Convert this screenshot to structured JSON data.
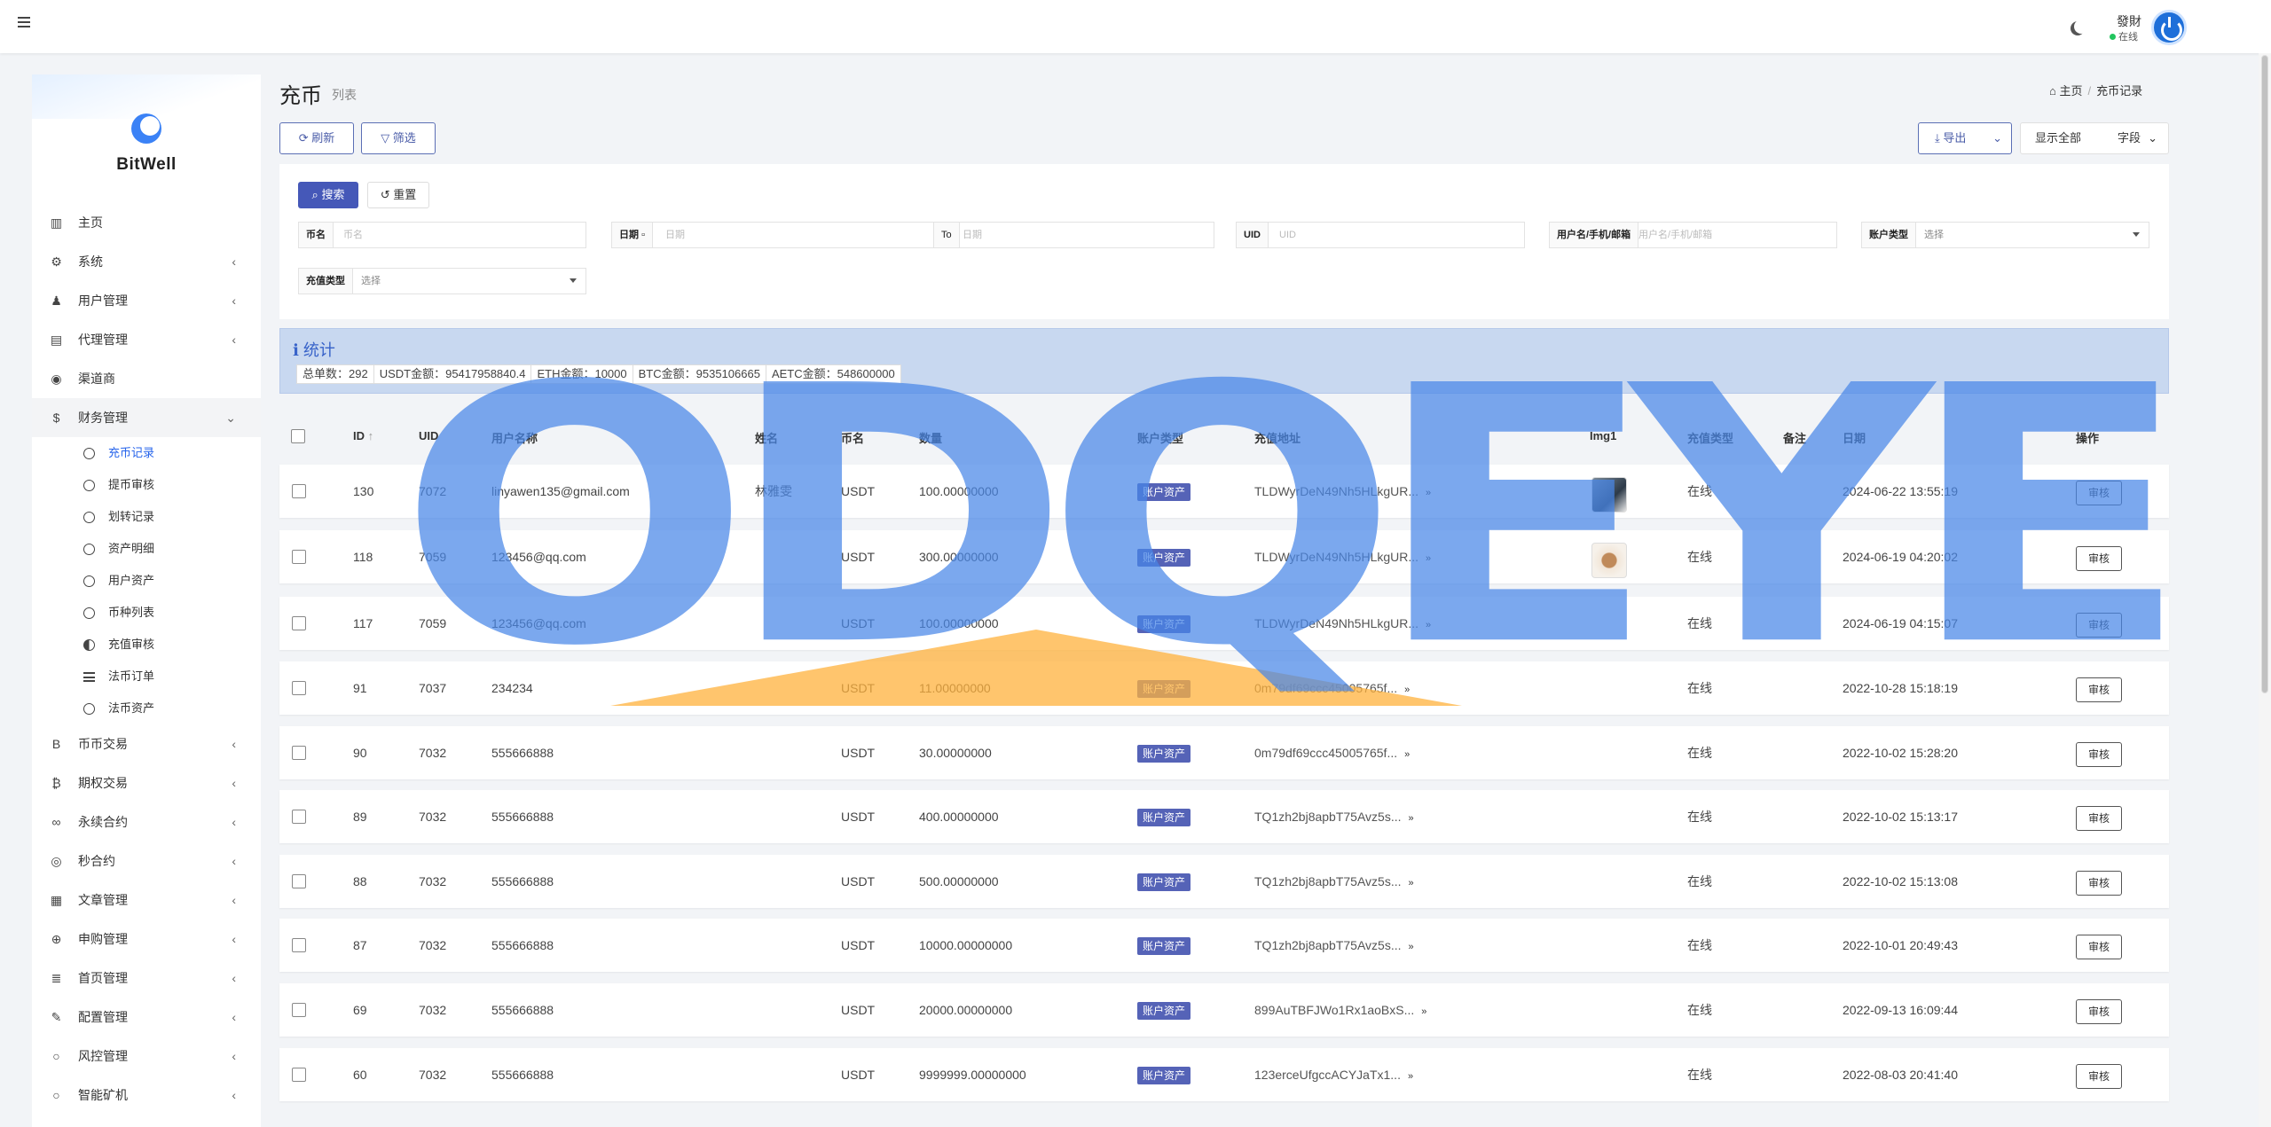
{
  "topbar": {
    "user_name": "發財",
    "user_status": "在线"
  },
  "brand": "BitWell",
  "sidebar": {
    "items": [
      {
        "label": "主页",
        "icon": "bar-chart-icon",
        "glyph": "▥",
        "chev": ""
      },
      {
        "label": "系统",
        "icon": "gear-icon",
        "glyph": "⚙",
        "chev": "‹"
      },
      {
        "label": "用户管理",
        "icon": "user-tie-icon",
        "glyph": "♟",
        "chev": "‹"
      },
      {
        "label": "代理管理",
        "icon": "id-card-icon",
        "glyph": "▤",
        "chev": "‹"
      },
      {
        "label": "渠道商",
        "icon": "user-circle-icon",
        "glyph": "◉",
        "chev": ""
      },
      {
        "label": "财务管理",
        "icon": "dollar-icon",
        "glyph": "$",
        "chev": "⌄"
      }
    ],
    "sub_items": [
      {
        "label": "充币记录",
        "icon": "circle-icon"
      },
      {
        "label": "提币审核",
        "icon": "circle-icon"
      },
      {
        "label": "划转记录",
        "icon": "circle-icon"
      },
      {
        "label": "资产明细",
        "icon": "circle-icon"
      },
      {
        "label": "用户资产",
        "icon": "circle-icon"
      },
      {
        "label": "币种列表",
        "icon": "circle-icon"
      },
      {
        "label": "充值审核",
        "icon": "half-circle-icon"
      },
      {
        "label": "法币订单",
        "icon": "list-icon"
      },
      {
        "label": "法币资产",
        "icon": "circle-icon"
      }
    ],
    "items2": [
      {
        "label": "币币交易",
        "icon": "bitcoin-b-icon",
        "glyph": "B",
        "chev": "‹"
      },
      {
        "label": "期权交易",
        "icon": "bitcoin-icon",
        "glyph": "₿",
        "chev": "‹"
      },
      {
        "label": "永续合约",
        "icon": "link-icon",
        "glyph": "∞",
        "chev": "‹"
      },
      {
        "label": "秒合约",
        "icon": "dot-circle-icon",
        "glyph": "◎",
        "chev": "‹"
      },
      {
        "label": "文章管理",
        "icon": "newspaper-icon",
        "glyph": "▦",
        "chev": "‹"
      },
      {
        "label": "申购管理",
        "icon": "globe-icon",
        "glyph": "⊕",
        "chev": "‹"
      },
      {
        "label": "首页管理",
        "icon": "bars-icon",
        "glyph": "≣",
        "chev": "‹"
      },
      {
        "label": "配置管理",
        "icon": "wrench-icon",
        "glyph": "✎",
        "chev": "‹"
      },
      {
        "label": "风控管理",
        "icon": "circle-icon",
        "glyph": "○",
        "chev": "‹"
      },
      {
        "label": "智能矿机",
        "icon": "circle-icon",
        "glyph": "○",
        "chev": "‹"
      }
    ]
  },
  "page": {
    "title": "充币",
    "subtitle": "列表"
  },
  "breadcrumb": {
    "home": "主页",
    "current": "充币记录"
  },
  "toolbar": {
    "refresh": "刷新",
    "filter": "筛选",
    "export": "导出",
    "show_all": "显示全部",
    "fields": "字段"
  },
  "filter": {
    "search": "搜索",
    "reset": "重置",
    "coin_label": "币名",
    "coin_ph": "币名",
    "date_label": "日期",
    "date_from_ph": "日期",
    "date_to": "To",
    "date_to_ph": "日期",
    "uid_label": "UID",
    "uid_ph": "UID",
    "user_label": "用户名/手机/邮箱",
    "user_ph": "用户名/手机/邮箱",
    "account_label": "账户类型",
    "account_value": "选择",
    "recharge_label": "充值类型",
    "recharge_value": "选择"
  },
  "stats": {
    "title": "统计",
    "items": [
      "总单数：292",
      "USDT金额：95417958840.4",
      "ETH金额：10000",
      "BTC金额：9535106665",
      "AETC金额：548600000"
    ]
  },
  "table": {
    "headers": [
      "ID",
      "UID",
      "用户名称",
      "姓名",
      "币名",
      "数量",
      "账户类型",
      "充值地址",
      "Img1",
      "充值类型",
      "备注",
      "日期",
      "操作"
    ],
    "rows": [
      {
        "id": "130",
        "uid": "7072",
        "user": "linyawen135@gmail.com",
        "name": "林雅雯",
        "coin": "USDT",
        "qty": "100.00000000",
        "acct": "账户资产",
        "addr": "TLDWyrDeN49Nh5HLkgUR...",
        "img": "y",
        "type": "在线",
        "note": "",
        "date": "2024-06-22 13:55:19",
        "action": "审核"
      },
      {
        "id": "118",
        "uid": "7059",
        "user": "123456@qq.com",
        "name": "",
        "coin": "USDT",
        "qty": "300.00000000",
        "acct": "账户资产",
        "addr": "TLDWyrDeN49Nh5HLkgUR...",
        "img": "y",
        "type": "在线",
        "note": "",
        "date": "2024-06-19 04:20:02",
        "action": "审核"
      },
      {
        "id": "117",
        "uid": "7059",
        "user": "123456@qq.com",
        "name": "",
        "coin": "USDT",
        "qty": "100.00000000",
        "acct": "账户资产",
        "addr": "TLDWyrDeN49Nh5HLkgUR...",
        "img": "",
        "type": "在线",
        "note": "",
        "date": "2024-06-19 04:15:07",
        "action": "审核"
      },
      {
        "id": "91",
        "uid": "7037",
        "user": "234234",
        "name": "",
        "coin": "USDT",
        "qty": "11.00000000",
        "acct": "账户资产",
        "addr": "0m79df69ccc45005765f...",
        "img": "",
        "type": "在线",
        "note": "",
        "date": "2022-10-28 15:18:19",
        "action": "审核"
      },
      {
        "id": "90",
        "uid": "7032",
        "user": "555666888",
        "name": "",
        "coin": "USDT",
        "qty": "30.00000000",
        "acct": "账户资产",
        "addr": "0m79df69ccc45005765f...",
        "img": "",
        "type": "在线",
        "note": "",
        "date": "2022-10-02 15:28:20",
        "action": "审核"
      },
      {
        "id": "89",
        "uid": "7032",
        "user": "555666888",
        "name": "",
        "coin": "USDT",
        "qty": "400.00000000",
        "acct": "账户资产",
        "addr": "TQ1zh2bj8apbT75Avz5s...",
        "img": "",
        "type": "在线",
        "note": "",
        "date": "2022-10-02 15:13:17",
        "action": "审核"
      },
      {
        "id": "88",
        "uid": "7032",
        "user": "555666888",
        "name": "",
        "coin": "USDT",
        "qty": "500.00000000",
        "acct": "账户资产",
        "addr": "TQ1zh2bj8apbT75Avz5s...",
        "img": "",
        "type": "在线",
        "note": "",
        "date": "2022-10-02 15:13:08",
        "action": "审核"
      },
      {
        "id": "87",
        "uid": "7032",
        "user": "555666888",
        "name": "",
        "coin": "USDT",
        "qty": "10000.00000000",
        "acct": "账户资产",
        "addr": "TQ1zh2bj8apbT75Avz5s...",
        "img": "",
        "type": "在线",
        "note": "",
        "date": "2022-10-01 20:49:43",
        "action": "审核"
      },
      {
        "id": "69",
        "uid": "7032",
        "user": "555666888",
        "name": "",
        "coin": "USDT",
        "qty": "20000.00000000",
        "acct": "账户资产",
        "addr": "899AuTBFJWo1Rx1aoBxS...",
        "img": "",
        "type": "在线",
        "note": "",
        "date": "2022-09-13 16:09:44",
        "action": "审核"
      },
      {
        "id": "60",
        "uid": "7032",
        "user": "555666888",
        "name": "",
        "coin": "USDT",
        "qty": "9999999.00000000",
        "acct": "账户资产",
        "addr": "123erceUfgccACYJaTx1...",
        "img": "",
        "type": "在线",
        "note": "",
        "date": "2022-08-03 20:41:40",
        "action": "审核"
      }
    ]
  },
  "watermark": "ODQEYE",
  "colors": {
    "accent": "#4558b8",
    "tag": "#5563b7",
    "online": "#22c55e",
    "stats_bg": "#c8d8f0"
  }
}
